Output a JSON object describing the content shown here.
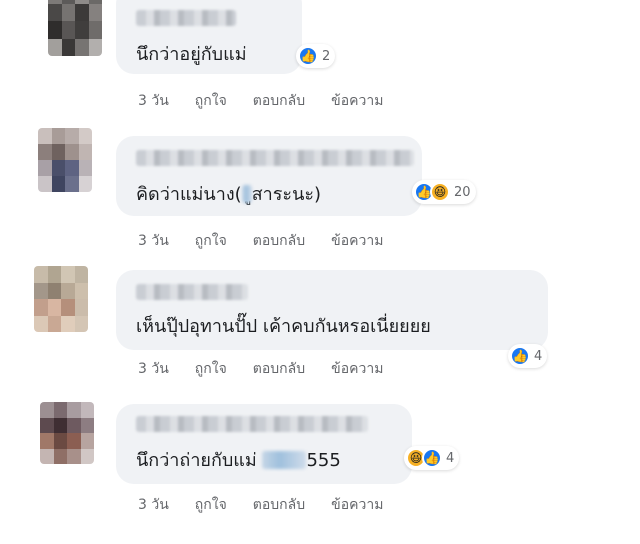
{
  "comments": [
    {
      "author": "",
      "text": "นึกว่าอยู่กับแม่",
      "text_suffix": "",
      "reactions": [
        "like"
      ],
      "reaction_count": "2",
      "time": "3 วัน",
      "like_label": "ถูกใจ",
      "reply_label": "ตอบกลับ",
      "message_label": "ข้อความ"
    },
    {
      "author": "",
      "text": "คิดว่าแม่นาง(",
      "text_suffix": "ูสาระนะ)",
      "reactions": [
        "like",
        "haha"
      ],
      "reaction_count": "20",
      "time": "3 วัน",
      "like_label": "ถูกใจ",
      "reply_label": "ตอบกลับ",
      "message_label": "ข้อความ"
    },
    {
      "author": "",
      "text": "เห็นปุ๊ปอุทานปั๊ป เค้าคบกันหรอเนี่ยยยย",
      "text_suffix": "",
      "reactions": [
        "like"
      ],
      "reaction_count": "4",
      "time": "3 วัน",
      "like_label": "ถูกใจ",
      "reply_label": "ตอบกลับ",
      "message_label": "ข้อความ"
    },
    {
      "author": "",
      "text": "นึกว่าถ่ายกับแม่ ",
      "text_suffix": "555",
      "reactions": [
        "haha",
        "like"
      ],
      "reaction_count": "4",
      "time": "3 วัน",
      "like_label": "ถูกใจ",
      "reply_label": "ตอบกลับ",
      "message_label": "ข้อความ"
    }
  ],
  "icons": {
    "like": "thumbs-up-icon",
    "haha": "laughing-face-icon"
  },
  "colors": {
    "bubble": "#f0f2f5",
    "like": "#1877f2",
    "haha": "#f7b125",
    "meta_text": "#65676b"
  }
}
